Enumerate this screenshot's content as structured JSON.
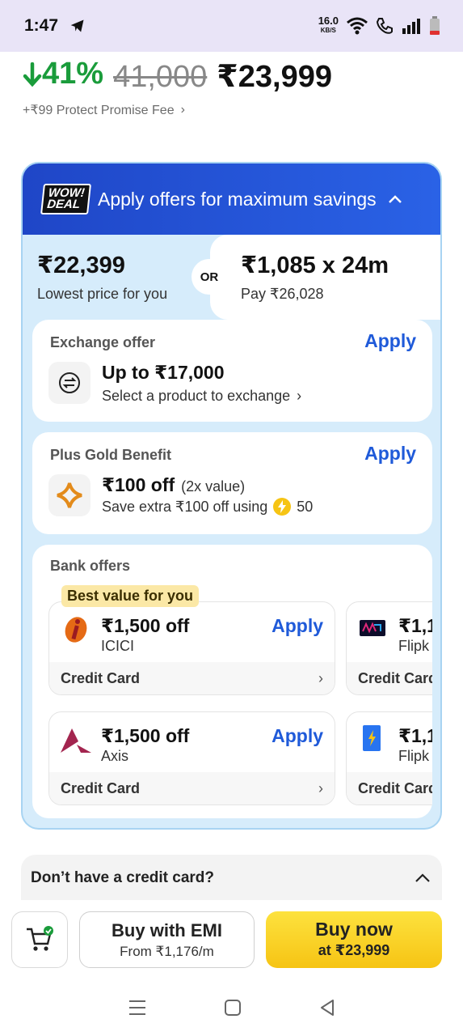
{
  "status_bar": {
    "time": "1:47",
    "speed_value": "16.0",
    "speed_unit": "KB/S"
  },
  "pricing": {
    "discount": "41%",
    "mrp": "41,000",
    "price": "₹23,999",
    "fee_text": "+₹99 Protect Promise Fee"
  },
  "offers": {
    "badge_line1": "WOW!",
    "badge_line2": "DEAL",
    "header_title": "Apply offers for maximum savings",
    "lowest_price": "₹22,399",
    "lowest_price_label": "Lowest price for you",
    "or_label": "OR",
    "emi_price": "₹1,085 x 24m",
    "emi_total": "Pay ₹26,028",
    "exchange": {
      "label": "Exchange offer",
      "apply": "Apply",
      "amount": "Up to ₹17,000",
      "sub": "Select a product to exchange"
    },
    "plus_gold": {
      "label": "Plus Gold Benefit",
      "apply": "Apply",
      "amount": "₹100 off",
      "value_note": "(2x value)",
      "sub": "Save extra ₹100 off using",
      "coins": "50"
    },
    "bank": {
      "label": "Bank offers",
      "best_tag": "Best value for you",
      "cards": [
        {
          "amount": "₹1,500 off",
          "bank": "ICICI",
          "apply": "Apply",
          "type": "Credit Card"
        },
        {
          "amount": "₹1,500 off",
          "bank": "Axis",
          "apply": "Apply",
          "type": "Credit Card"
        },
        {
          "amount": "₹1,1",
          "bank": "Flipk",
          "type": "Credit Card"
        },
        {
          "amount": "₹1,1",
          "bank": "Flipk",
          "type": "Credit Card"
        }
      ]
    }
  },
  "no_card": {
    "text": "Don’t have a credit card?"
  },
  "bottom": {
    "emi_title": "Buy with EMI",
    "emi_sub": "From ₹1,176/m",
    "buy_title": "Buy now",
    "buy_sub": "at ₹23,999"
  },
  "colors": {
    "accent": "#1f5ad9",
    "discount": "#1a9c3b",
    "buy": "#f6c414",
    "offer_bg": "#d6ecfb"
  },
  "icons": [
    "telegram-icon",
    "wifi-icon",
    "call-icon",
    "signal-icon",
    "battery-icon",
    "exchange-icon",
    "plus-gold-icon",
    "coin-icon",
    "icici-logo-icon",
    "axis-logo-icon",
    "cart-icon",
    "menu-icon",
    "home-icon",
    "back-icon"
  ]
}
